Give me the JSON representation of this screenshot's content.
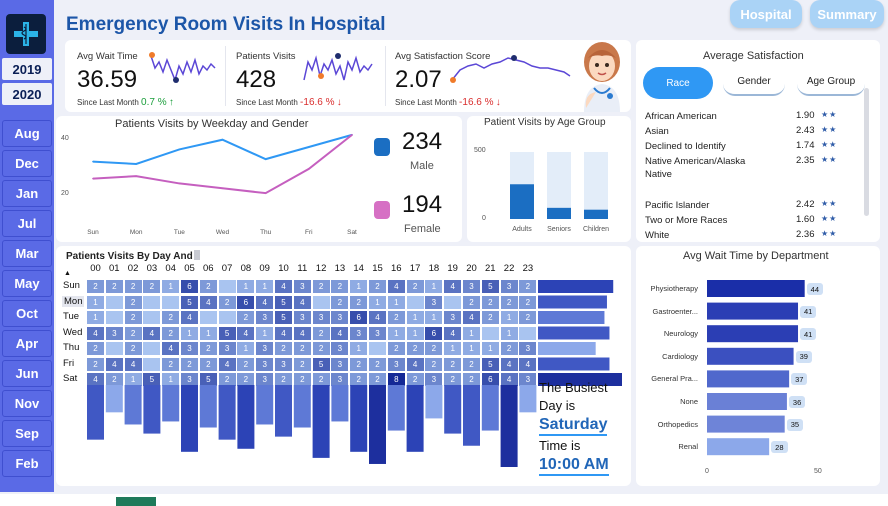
{
  "header": {
    "title": "Emergency Room Visits In Hospital",
    "hospital_btn": "Hospital",
    "summary_btn": "Summary"
  },
  "sidebar": {
    "years": [
      "2019",
      "2020"
    ],
    "months": [
      "Aug",
      "Dec",
      "Jan",
      "Jul",
      "Mar",
      "May",
      "Oct",
      "Apr",
      "Jun",
      "Nov",
      "Sep",
      "Feb"
    ]
  },
  "kpis": [
    {
      "label": "Avg Wait Time",
      "value": "36.59",
      "since": "Since Last Month",
      "change": "0.7 %",
      "arrow": "↑",
      "trend": "up"
    },
    {
      "label": "Patients Visits",
      "value": "428",
      "since": "Since Last Month",
      "change": "-16.6 %",
      "arrow": "↓",
      "trend": "down"
    },
    {
      "label": "Avg Satisfaction Score",
      "value": "2.07",
      "since": "Since Last Month",
      "change": "-16.6 %",
      "arrow": "↓",
      "trend": "down"
    }
  ],
  "weekday_chart": {
    "title": "Patients Visits by Weekday and Gender",
    "y_ticks": [
      "40",
      "20"
    ],
    "male_legend": {
      "value": "234",
      "label": "Male",
      "color": "#1b6ec2"
    },
    "female_legend": {
      "value": "194",
      "label": "Female",
      "color": "#d670c4"
    }
  },
  "age_chart": {
    "title": "Patient Visits by Age Group",
    "y_ticks": [
      "500",
      "0"
    ]
  },
  "satisfaction": {
    "title": "Average Satisfaction",
    "tabs": [
      "Race",
      "Gender",
      "Age Group"
    ],
    "rows": [
      {
        "name": "African American",
        "value": "1.90",
        "stars": "★★"
      },
      {
        "name": "Asian",
        "value": "2.43",
        "stars": "★★"
      },
      {
        "name": "Declined to Identify",
        "value": "1.74",
        "stars": "★★"
      },
      {
        "name": "Native American/Alaska Native",
        "value": "2.35",
        "stars": "★★"
      },
      {
        "name": "Pacific Islander",
        "value": "2.42",
        "stars": "★★"
      },
      {
        "name": "Two or More Races",
        "value": "1.60",
        "stars": "★★"
      },
      {
        "name": "White",
        "value": "2.36",
        "stars": "★★"
      }
    ]
  },
  "heatmap": {
    "title": "Patients Visits By Day And",
    "hours": [
      "00",
      "01",
      "02",
      "03",
      "04",
      "05",
      "06",
      "07",
      "08",
      "09",
      "10",
      "11",
      "12",
      "13",
      "14",
      "15",
      "16",
      "17",
      "18",
      "19",
      "20",
      "21",
      "22",
      "23"
    ],
    "days": [
      "Sun",
      "Mon",
      "Tue",
      "Wed",
      "Thu",
      "Fri",
      "Sat"
    ],
    "values": [
      [
        2,
        2,
        2,
        2,
        1,
        6,
        2,
        null,
        1,
        1,
        4,
        3,
        2,
        2,
        1,
        2,
        4,
        2,
        1,
        4,
        3,
        5,
        3,
        2
      ],
      [
        1,
        null,
        2,
        null,
        null,
        5,
        4,
        2,
        6,
        4,
        5,
        4,
        null,
        2,
        2,
        1,
        1,
        null,
        3,
        null,
        2,
        2,
        2,
        2
      ],
      [
        1,
        null,
        2,
        null,
        2,
        4,
        null,
        null,
        2,
        3,
        5,
        3,
        3,
        3,
        6,
        4,
        2,
        1,
        1,
        3,
        4,
        2,
        1,
        2
      ],
      [
        4,
        3,
        2,
        4,
        2,
        1,
        1,
        5,
        4,
        1,
        4,
        4,
        2,
        4,
        3,
        3,
        1,
        1,
        6,
        4,
        1,
        null,
        1,
        null
      ],
      [
        2,
        null,
        2,
        null,
        4,
        3,
        2,
        3,
        1,
        3,
        2,
        2,
        2,
        3,
        1,
        null,
        2,
        2,
        2,
        1,
        1,
        1,
        2,
        3
      ],
      [
        2,
        4,
        4,
        null,
        2,
        2,
        2,
        4,
        2,
        3,
        3,
        2,
        5,
        3,
        2,
        2,
        3,
        4,
        2,
        2,
        2,
        5,
        4,
        4
      ],
      [
        4,
        2,
        1,
        5,
        1,
        3,
        5,
        2,
        2,
        3,
        2,
        2,
        2,
        3,
        2,
        2,
        8,
        2,
        3,
        2,
        2,
        6,
        4,
        3
      ]
    ],
    "hour_totals": [
      18,
      9,
      13,
      16,
      12,
      22,
      14,
      18,
      21,
      13,
      17,
      14,
      24,
      12,
      22,
      26,
      15,
      22,
      11,
      16,
      20,
      15,
      27,
      9
    ],
    "day_totals": [
      60,
      55,
      53,
      57,
      46,
      57,
      67
    ],
    "busiest_day_prefix": "The Busiest",
    "busiest_day_label": "Day is",
    "busiest_day": "Saturday",
    "busiest_time_label": "Time is",
    "busiest_time": "10:00 AM"
  },
  "dept_chart": {
    "title": "Avg Wait Time by Department",
    "x_ticks": [
      "0",
      "50"
    ]
  },
  "chart_data": [
    {
      "type": "line",
      "title": "Patients Visits by Weekday and Gender",
      "categories": [
        "Sun",
        "Mon",
        "Tue",
        "Wed",
        "Thu",
        "Fri",
        "Sat"
      ],
      "series": [
        {
          "name": "Male",
          "values": [
            32,
            31,
            37,
            41,
            33,
            38,
            43
          ],
          "color": "#2f98f4"
        },
        {
          "name": "Female",
          "values": [
            25,
            26,
            23,
            21,
            19,
            29,
            43
          ],
          "color": "#c55fbf"
        }
      ],
      "ylim": [
        10,
        45
      ]
    },
    {
      "type": "bar",
      "title": "Patient Visits by Age Group",
      "categories": [
        "Adults",
        "Seniors",
        "Children"
      ],
      "values": [
        280,
        90,
        75
      ],
      "ylim": [
        0,
        540
      ],
      "color": "#1b6ec2",
      "background_color": "#e3edf9"
    },
    {
      "type": "bar",
      "title": "Avg Wait Time by Department",
      "orientation": "horizontal",
      "categories": [
        "Physiotherapy",
        "Gastroenter...",
        "Neurology",
        "Cardiology",
        "General Pra...",
        "None",
        "Orthopedics",
        "Renal"
      ],
      "values": [
        44,
        41,
        41,
        39,
        37,
        36,
        35,
        28
      ],
      "xlim": [
        0,
        50
      ],
      "colors": [
        "#1a2ea8",
        "#2b3eb4",
        "#2b3eb4",
        "#3b50c0",
        "#5068cc",
        "#6a80d6",
        "#6e84d8",
        "#8ca8ea"
      ]
    }
  ]
}
